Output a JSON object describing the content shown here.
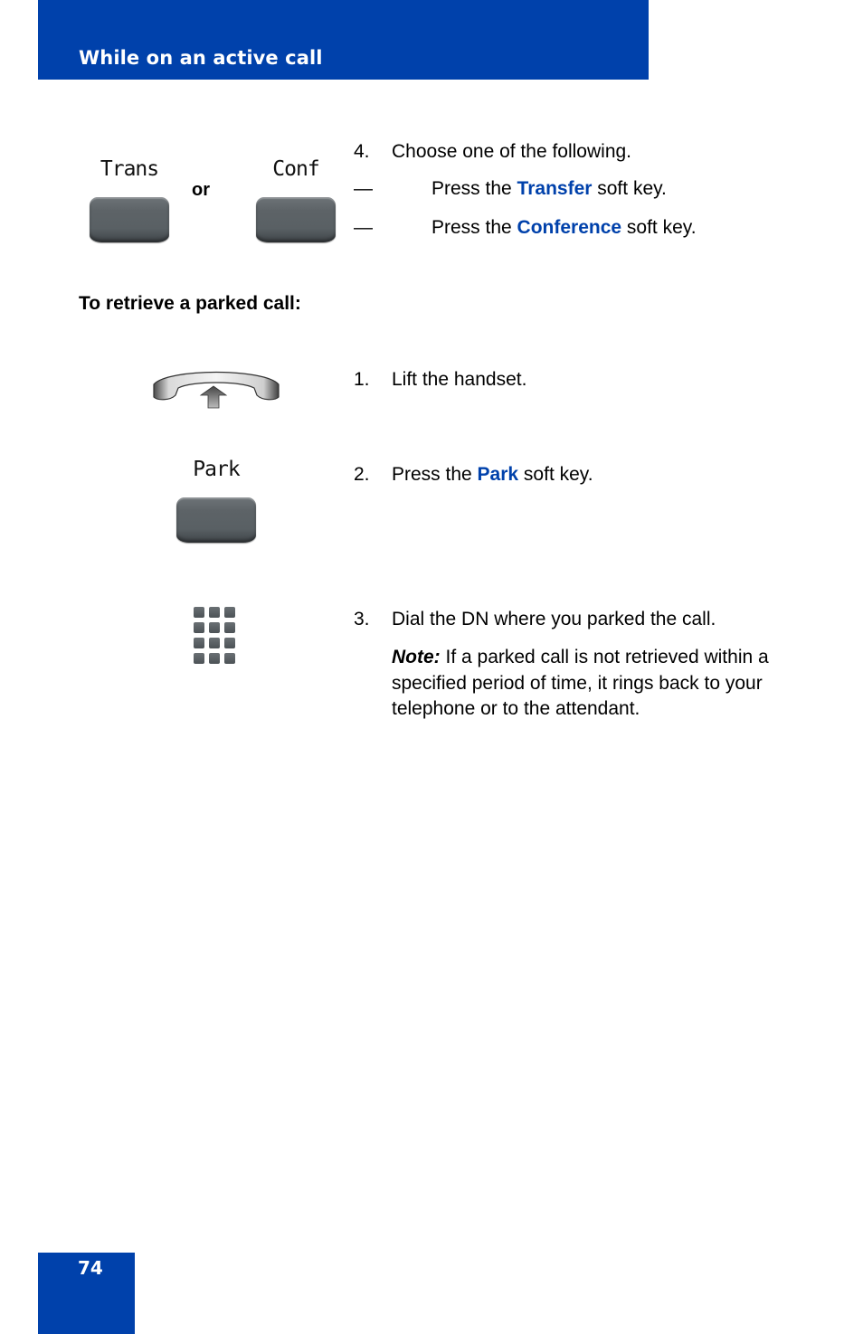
{
  "header": {
    "title": "While on an active call"
  },
  "footer": {
    "page_number": "74"
  },
  "transfer_step": {
    "softkeys": [
      {
        "label": "Trans"
      },
      {
        "label": "Conf"
      }
    ],
    "or_label": "or",
    "number": "4.",
    "text": "Choose one of the following.",
    "options": [
      {
        "dash": "—",
        "prefix": "Press the ",
        "keyword": "Transfer",
        "suffix": " soft key."
      },
      {
        "dash": "—",
        "prefix": "Press the ",
        "keyword": "Conference",
        "suffix": " soft key."
      }
    ]
  },
  "retrieve_section": {
    "heading": "To retrieve a parked call:",
    "steps": [
      {
        "number": "1.",
        "text": "Lift the handset.",
        "icon": "handset-lift-icon"
      },
      {
        "number": "2.",
        "prefix": "Press the ",
        "keyword": "Park",
        "suffix": " soft key.",
        "softkey_label": "Park"
      },
      {
        "number": "3.",
        "text": "Dial the DN where you parked the call.",
        "icon": "dialpad-icon",
        "note_label": "Note:",
        "note_text": " If a parked call is not retrieved within a specified period of time, it rings back to your telephone or to the attendant."
      }
    ]
  },
  "colors": {
    "brand_blue": "#0041ab"
  }
}
